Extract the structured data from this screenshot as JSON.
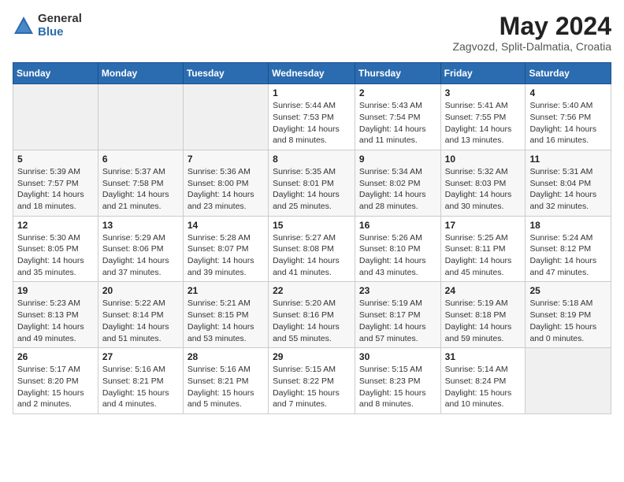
{
  "logo": {
    "general": "General",
    "blue": "Blue"
  },
  "title": "May 2024",
  "subtitle": "Zagvozd, Split-Dalmatia, Croatia",
  "days_of_week": [
    "Sunday",
    "Monday",
    "Tuesday",
    "Wednesday",
    "Thursday",
    "Friday",
    "Saturday"
  ],
  "weeks": [
    [
      {
        "num": "",
        "info": ""
      },
      {
        "num": "",
        "info": ""
      },
      {
        "num": "",
        "info": ""
      },
      {
        "num": "1",
        "info": "Sunrise: 5:44 AM\nSunset: 7:53 PM\nDaylight: 14 hours and 8 minutes."
      },
      {
        "num": "2",
        "info": "Sunrise: 5:43 AM\nSunset: 7:54 PM\nDaylight: 14 hours and 11 minutes."
      },
      {
        "num": "3",
        "info": "Sunrise: 5:41 AM\nSunset: 7:55 PM\nDaylight: 14 hours and 13 minutes."
      },
      {
        "num": "4",
        "info": "Sunrise: 5:40 AM\nSunset: 7:56 PM\nDaylight: 14 hours and 16 minutes."
      }
    ],
    [
      {
        "num": "5",
        "info": "Sunrise: 5:39 AM\nSunset: 7:57 PM\nDaylight: 14 hours and 18 minutes."
      },
      {
        "num": "6",
        "info": "Sunrise: 5:37 AM\nSunset: 7:58 PM\nDaylight: 14 hours and 21 minutes."
      },
      {
        "num": "7",
        "info": "Sunrise: 5:36 AM\nSunset: 8:00 PM\nDaylight: 14 hours and 23 minutes."
      },
      {
        "num": "8",
        "info": "Sunrise: 5:35 AM\nSunset: 8:01 PM\nDaylight: 14 hours and 25 minutes."
      },
      {
        "num": "9",
        "info": "Sunrise: 5:34 AM\nSunset: 8:02 PM\nDaylight: 14 hours and 28 minutes."
      },
      {
        "num": "10",
        "info": "Sunrise: 5:32 AM\nSunset: 8:03 PM\nDaylight: 14 hours and 30 minutes."
      },
      {
        "num": "11",
        "info": "Sunrise: 5:31 AM\nSunset: 8:04 PM\nDaylight: 14 hours and 32 minutes."
      }
    ],
    [
      {
        "num": "12",
        "info": "Sunrise: 5:30 AM\nSunset: 8:05 PM\nDaylight: 14 hours and 35 minutes."
      },
      {
        "num": "13",
        "info": "Sunrise: 5:29 AM\nSunset: 8:06 PM\nDaylight: 14 hours and 37 minutes."
      },
      {
        "num": "14",
        "info": "Sunrise: 5:28 AM\nSunset: 8:07 PM\nDaylight: 14 hours and 39 minutes."
      },
      {
        "num": "15",
        "info": "Sunrise: 5:27 AM\nSunset: 8:08 PM\nDaylight: 14 hours and 41 minutes."
      },
      {
        "num": "16",
        "info": "Sunrise: 5:26 AM\nSunset: 8:10 PM\nDaylight: 14 hours and 43 minutes."
      },
      {
        "num": "17",
        "info": "Sunrise: 5:25 AM\nSunset: 8:11 PM\nDaylight: 14 hours and 45 minutes."
      },
      {
        "num": "18",
        "info": "Sunrise: 5:24 AM\nSunset: 8:12 PM\nDaylight: 14 hours and 47 minutes."
      }
    ],
    [
      {
        "num": "19",
        "info": "Sunrise: 5:23 AM\nSunset: 8:13 PM\nDaylight: 14 hours and 49 minutes."
      },
      {
        "num": "20",
        "info": "Sunrise: 5:22 AM\nSunset: 8:14 PM\nDaylight: 14 hours and 51 minutes."
      },
      {
        "num": "21",
        "info": "Sunrise: 5:21 AM\nSunset: 8:15 PM\nDaylight: 14 hours and 53 minutes."
      },
      {
        "num": "22",
        "info": "Sunrise: 5:20 AM\nSunset: 8:16 PM\nDaylight: 14 hours and 55 minutes."
      },
      {
        "num": "23",
        "info": "Sunrise: 5:19 AM\nSunset: 8:17 PM\nDaylight: 14 hours and 57 minutes."
      },
      {
        "num": "24",
        "info": "Sunrise: 5:19 AM\nSunset: 8:18 PM\nDaylight: 14 hours and 59 minutes."
      },
      {
        "num": "25",
        "info": "Sunrise: 5:18 AM\nSunset: 8:19 PM\nDaylight: 15 hours and 0 minutes."
      }
    ],
    [
      {
        "num": "26",
        "info": "Sunrise: 5:17 AM\nSunset: 8:20 PM\nDaylight: 15 hours and 2 minutes."
      },
      {
        "num": "27",
        "info": "Sunrise: 5:16 AM\nSunset: 8:21 PM\nDaylight: 15 hours and 4 minutes."
      },
      {
        "num": "28",
        "info": "Sunrise: 5:16 AM\nSunset: 8:21 PM\nDaylight: 15 hours and 5 minutes."
      },
      {
        "num": "29",
        "info": "Sunrise: 5:15 AM\nSunset: 8:22 PM\nDaylight: 15 hours and 7 minutes."
      },
      {
        "num": "30",
        "info": "Sunrise: 5:15 AM\nSunset: 8:23 PM\nDaylight: 15 hours and 8 minutes."
      },
      {
        "num": "31",
        "info": "Sunrise: 5:14 AM\nSunset: 8:24 PM\nDaylight: 15 hours and 10 minutes."
      },
      {
        "num": "",
        "info": ""
      }
    ]
  ]
}
